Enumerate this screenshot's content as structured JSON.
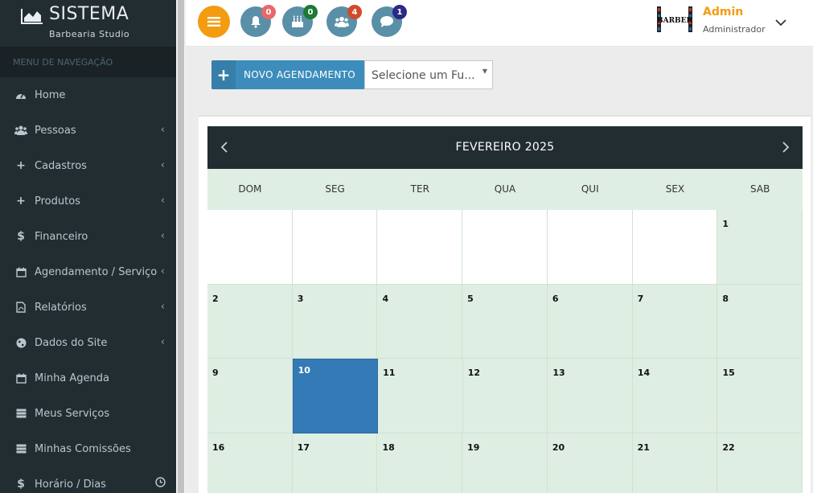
{
  "brand": {
    "title": "SISTEMA",
    "subtitle": "Barbearia Studio"
  },
  "sidebar": {
    "header": "MENU DE NAVEGAÇÃO",
    "items": [
      {
        "label": "Home",
        "icon": "dashboard-icon",
        "submenu": false
      },
      {
        "label": "Pessoas",
        "icon": "users-icon",
        "submenu": true
      },
      {
        "label": "Cadastros",
        "icon": "plus-icon",
        "submenu": true
      },
      {
        "label": "Produtos",
        "icon": "plus-icon",
        "submenu": true
      },
      {
        "label": "Financeiro",
        "icon": "dollar-icon",
        "submenu": true
      },
      {
        "label": "Agendamento / Serviço",
        "icon": "calendar-icon",
        "submenu": true
      },
      {
        "label": "Relatórios",
        "icon": "pdf-icon",
        "submenu": true
      },
      {
        "label": "Dados do Site",
        "icon": "globe-icon",
        "submenu": true
      },
      {
        "label": "Minha Agenda",
        "icon": "calendar-icon",
        "submenu": false
      },
      {
        "label": "Meus Serviços",
        "icon": "server-icon",
        "submenu": false
      },
      {
        "label": "Minhas Comissões",
        "icon": "server-icon",
        "submenu": false
      },
      {
        "label": "Horário / Dias",
        "icon": "dollar-icon",
        "submenu": false
      }
    ]
  },
  "topbar": {
    "notifications": [
      {
        "icon": "bell-icon",
        "count": "0",
        "badge_color": "#e8696a"
      },
      {
        "icon": "birthday-cake-icon",
        "count": "0",
        "badge_color": "#1e7a34"
      },
      {
        "icon": "users-icon",
        "count": "4",
        "badge_color": "#d14b2a"
      },
      {
        "icon": "comment-icon",
        "count": "1",
        "badge_color": "#2a2a86"
      }
    ],
    "user": {
      "name": "Admin",
      "role": "Administrador",
      "logo_text": "BARBER"
    }
  },
  "actions": {
    "new_label": "NOVO AGENDAMENTO",
    "select_value": "Selecione um Fu..."
  },
  "calendar": {
    "title": "FEVEREIRO 2025",
    "weekdays": [
      "DOM",
      "SEG",
      "TER",
      "QUA",
      "QUI",
      "SEX",
      "SAB"
    ],
    "weeks": [
      [
        "",
        "",
        "",
        "",
        "",
        "",
        "1"
      ],
      [
        "2",
        "3",
        "4",
        "5",
        "6",
        "7",
        "8"
      ],
      [
        "9",
        "10",
        "11",
        "12",
        "13",
        "14",
        "15"
      ],
      [
        "16",
        "17",
        "18",
        "19",
        "20",
        "21",
        "22"
      ]
    ],
    "today": "10"
  },
  "colors": {
    "sidebar_bg": "#222d32",
    "accent_orange": "#f39c12",
    "primary_blue": "#3c8dbc",
    "calendar_cell": "#dfeee2",
    "today_blue": "#337ab7"
  }
}
